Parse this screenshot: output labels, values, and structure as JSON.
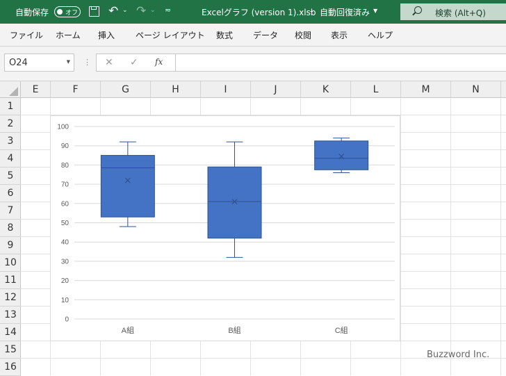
{
  "titlebar": {
    "autosave_label": "自動保存",
    "autosave_state": "オフ",
    "filename": "Excelグラフ (version 1).xlsb",
    "separator": "-",
    "save_status": "自動回復済み",
    "search_label": "検索 (Alt+Q)"
  },
  "ribbon": {
    "tabs": [
      "ファイル",
      "ホーム",
      "挿入",
      "ページ レイアウト",
      "数式",
      "データ",
      "校閲",
      "表示",
      "ヘルプ"
    ]
  },
  "formula_bar": {
    "cell_ref": "O24",
    "fx": "fx",
    "cancel_icon": "x-icon",
    "enter_icon": "check-icon",
    "value": ""
  },
  "columns": [
    "E",
    "F",
    "G",
    "H",
    "I",
    "J",
    "K",
    "L",
    "M",
    "N"
  ],
  "rows": [
    "1",
    "2",
    "3",
    "4",
    "5",
    "6",
    "7",
    "8",
    "9",
    "10",
    "11",
    "12",
    "13",
    "14",
    "15",
    "16"
  ],
  "chart_data": {
    "type": "box",
    "categories": [
      "A組",
      "B組",
      "C組"
    ],
    "series": [
      {
        "min": 48,
        "q1": 53,
        "median": 78.5,
        "q3": 85,
        "max": 92,
        "mean": 72
      },
      {
        "min": 32,
        "q1": 42,
        "median": 61,
        "q3": 79,
        "max": 92,
        "mean": 61
      },
      {
        "min": 76,
        "q1": 77.5,
        "median": 83.5,
        "q3": 92.5,
        "max": 94,
        "mean": 84.5
      }
    ],
    "ylim": [
      0,
      100
    ],
    "yticks": [
      "0",
      "10",
      "20",
      "30",
      "40",
      "50",
      "60",
      "70",
      "80",
      "90",
      "100"
    ],
    "grid": true,
    "legend": "none",
    "box_color": "#4472c4",
    "box_edge": "#2f528f"
  },
  "watermark": "Buzzword Inc."
}
